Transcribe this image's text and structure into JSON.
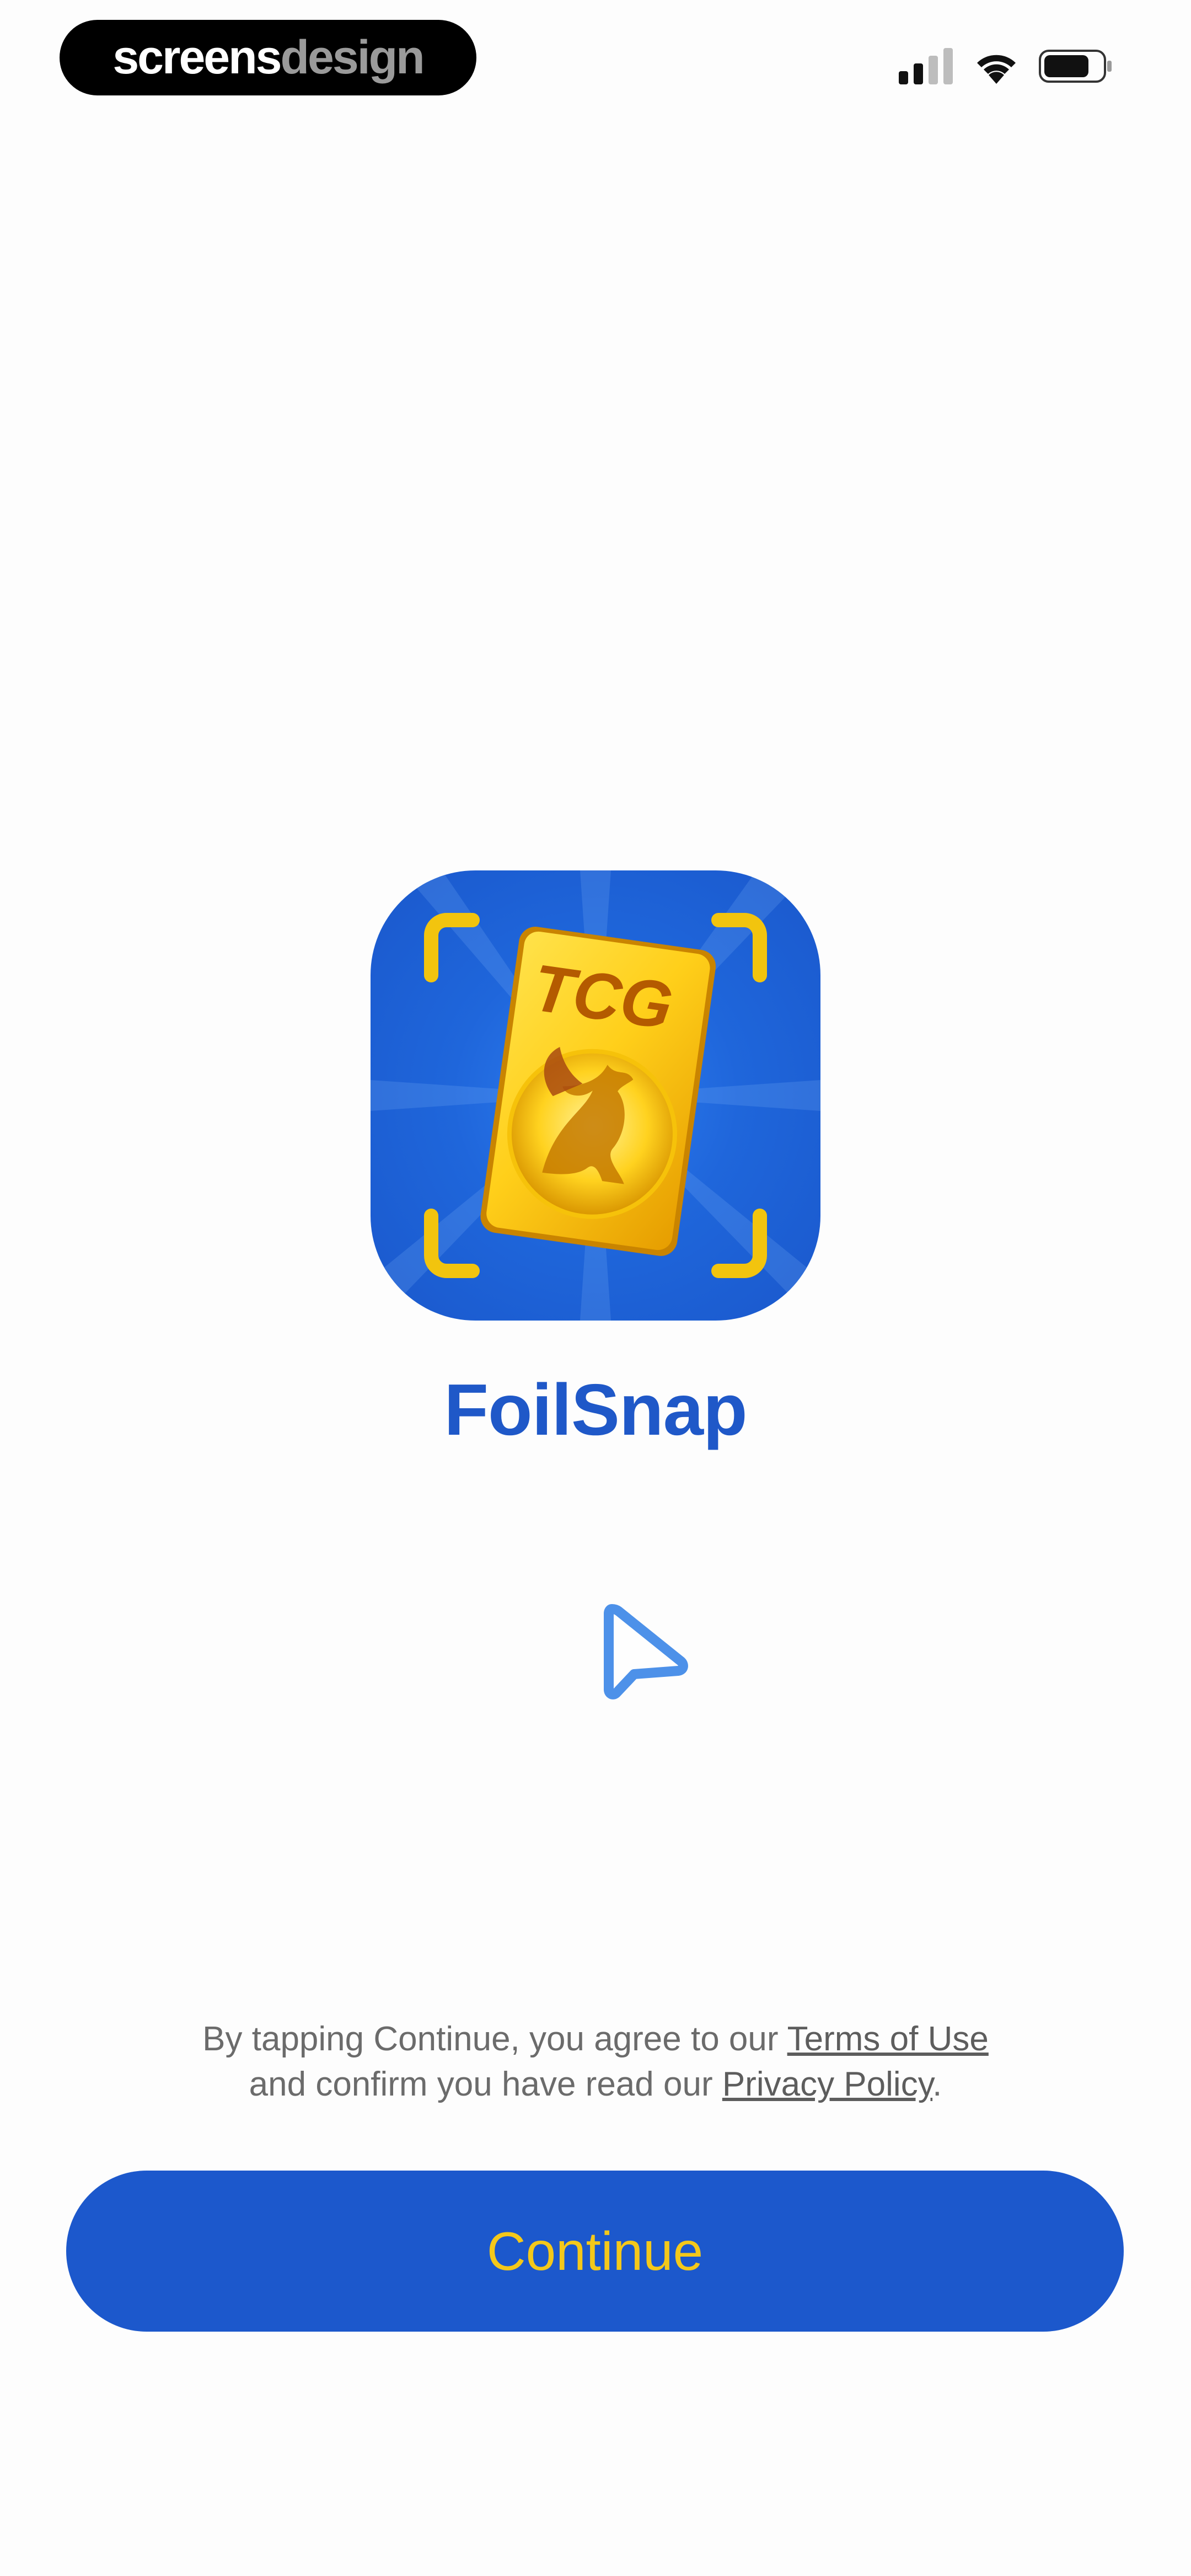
{
  "watermark": {
    "part1": "screens",
    "part2": "design"
  },
  "status_bar": {
    "signal_icon": "cellular-signal-icon",
    "wifi_icon": "wifi-icon",
    "battery_icon": "battery-icon"
  },
  "app": {
    "icon_name": "foilsnap-app-icon",
    "icon_text": "TCG",
    "name": "FoilSnap"
  },
  "legal": {
    "line1_prefix": "By tapping Continue, you agree to our ",
    "terms_link": "Terms of Use",
    "line2_prefix": "and confirm you have read our ",
    "privacy_link": "Privacy Policy",
    "line2_suffix": "."
  },
  "continue_button": {
    "label": "Continue"
  },
  "colors": {
    "brand_blue": "#1c58cc",
    "accent_yellow": "#f4c81a",
    "title_blue": "#1f58c8"
  }
}
